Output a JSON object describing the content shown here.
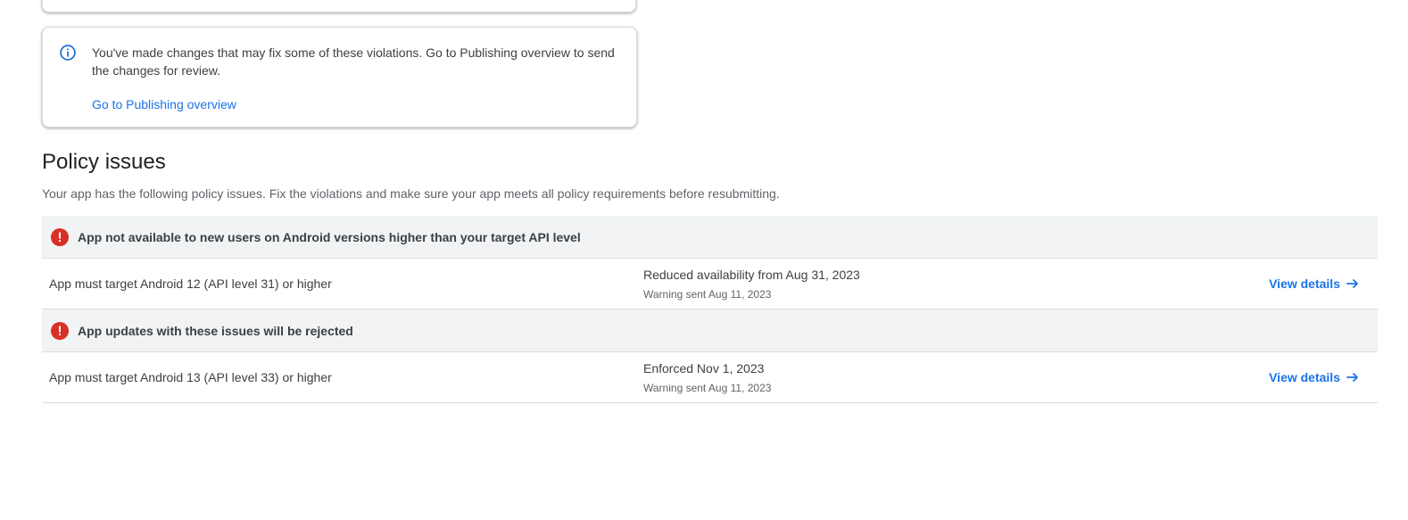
{
  "info_card": {
    "message": "You've made changes that may fix some of these violations. Go to Publishing overview to send the changes for review.",
    "link_label": "Go to Publishing overview",
    "icon": "info-icon"
  },
  "policy_issues": {
    "title": "Policy issues",
    "description": "Your app has the following policy issues. Fix the violations and make sure your app meets all policy requirements before resubmitting.",
    "groups": [
      {
        "title": "App not available to new users on Android versions higher than your target API level",
        "icon": "error-icon",
        "issue": {
          "name": "App must target Android 12 (API level 31) or higher",
          "status": "Reduced availability from Aug 31, 2023",
          "warning": "Warning sent Aug 11, 2023",
          "action_label": "View details"
        }
      },
      {
        "title": "App updates with these issues will be rejected",
        "icon": "error-icon",
        "issue": {
          "name": "App must target Android 13 (API level 33) or higher",
          "status": "Enforced Nov 1, 2023",
          "warning": "Warning sent Aug 11, 2023",
          "action_label": "View details"
        }
      }
    ]
  },
  "colors": {
    "link": "#1a73e8",
    "error": "#d93025",
    "info": "#1967d2",
    "group_bg": "#f1f3f4"
  }
}
